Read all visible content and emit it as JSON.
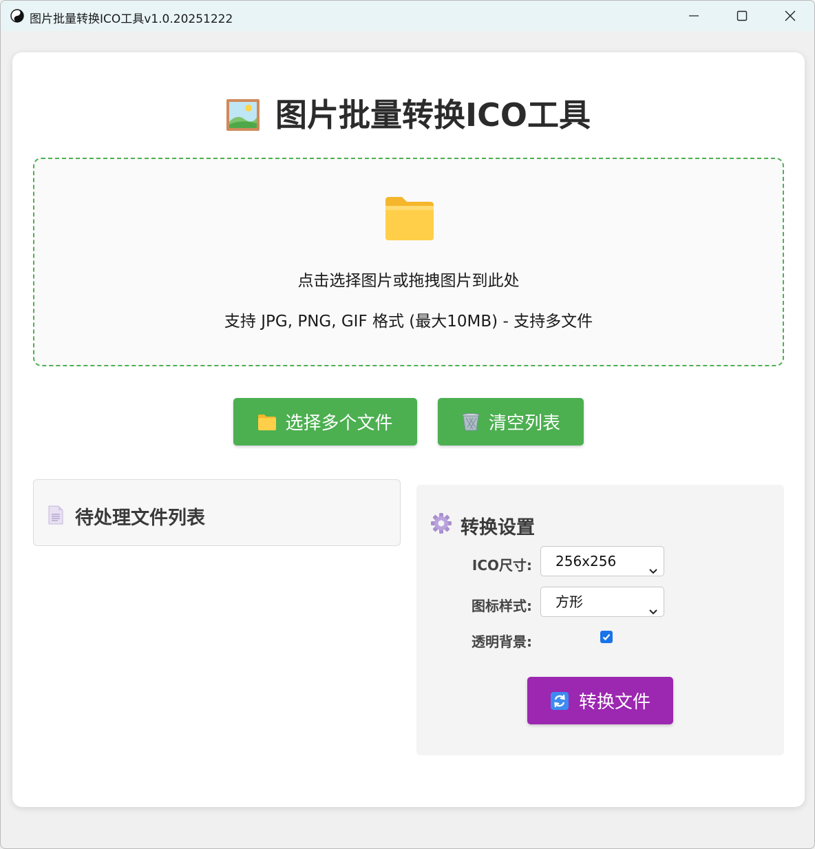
{
  "window": {
    "title": "图片批量转换ICO工具v1.0.20251222"
  },
  "header": {
    "title": "图片批量转换ICO工具"
  },
  "dropzone": {
    "primary_text": "点击选择图片或拖拽图片到此处",
    "secondary_text": "支持 JPG, PNG, GIF 格式 (最大10MB) - 支持多文件"
  },
  "actions": {
    "select_files_label": "选择多个文件",
    "clear_list_label": "清空列表"
  },
  "file_list": {
    "title": "待处理文件列表"
  },
  "settings": {
    "title": "转换设置",
    "size_label": "ICO尺寸:",
    "size_value": "256x256",
    "style_label": "图标样式:",
    "style_value": "方形",
    "transparent_label": "透明背景:",
    "transparent_checked": true,
    "convert_label": "转换文件"
  },
  "colors": {
    "accent_green": "#4caf50",
    "accent_purple": "#9c27b0",
    "checkbox_blue": "#1a73e8"
  },
  "icons": {
    "app": "yin-yang-icon",
    "title": "framed-picture-icon",
    "dropzone": "folder-icon",
    "select": "folder-icon",
    "clear": "wastebasket-icon",
    "file_list": "document-icon",
    "settings": "gear-icon",
    "convert": "refresh-icon"
  }
}
